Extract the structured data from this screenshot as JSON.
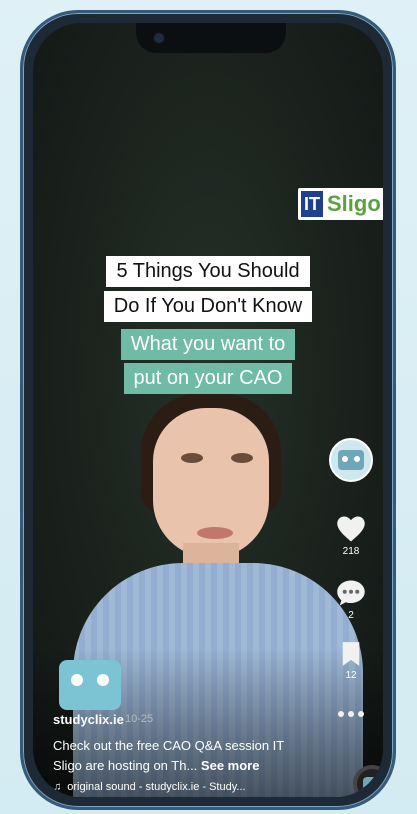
{
  "overlay": {
    "logo_mark": "IT",
    "logo_text": "Sligo",
    "caption_line1": "5 Things You Should",
    "caption_line2": "Do If You Don't Know",
    "caption_line3": "What you want to",
    "caption_line4": "put on your CAO"
  },
  "actions": {
    "likes": "218",
    "comments": "2",
    "saves": "12"
  },
  "post": {
    "username": "studyclix.ie",
    "time": "10-25",
    "description": "Check out the free CAO Q&A session IT Sligo are hosting on Th...",
    "see_more": "See more",
    "sound": "original sound - studyclix.ie - Study..."
  },
  "colors": {
    "accent_teal": "#6fbba5",
    "logo_green": "#5aa23b",
    "logo_blue": "#1f3f8f"
  }
}
